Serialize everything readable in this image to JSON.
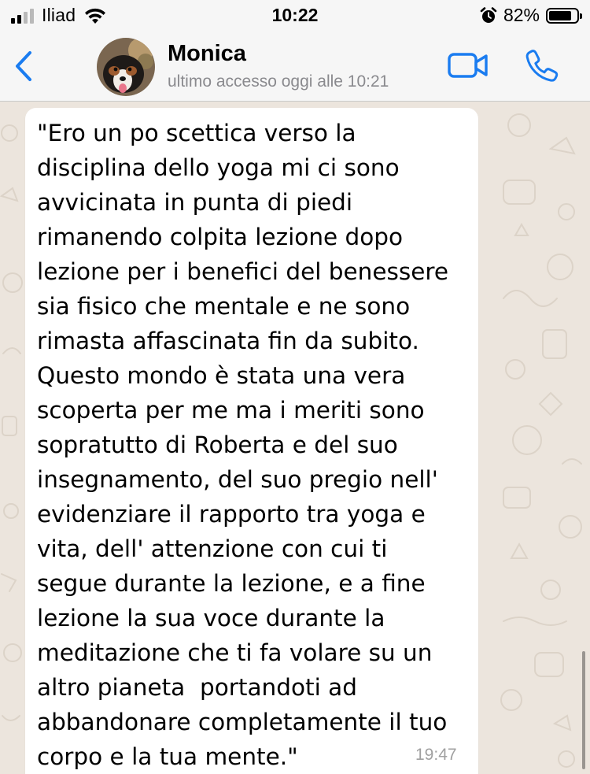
{
  "status_bar": {
    "carrier": "Iliad",
    "time": "10:22",
    "battery_percent": "82%",
    "battery_level": 0.82,
    "icons": [
      "signal-icon",
      "wifi-icon",
      "alarm-icon",
      "battery-icon"
    ]
  },
  "header": {
    "contact_name": "Monica",
    "last_seen": "ultimo accesso oggi alle 10:21",
    "accent_color": "#1a7cf0",
    "icons": [
      "back-chevron-icon",
      "video-camera-icon",
      "phone-icon"
    ]
  },
  "chat": {
    "messages": [
      {
        "lines": [
          "\"Ero un po scettica verso la",
          "disciplina dello yoga mi ci sono",
          "avvicinata in punta di piedi",
          "rimanendo colpita lezione dopo",
          "lezione per i benefici del benessere",
          "sia fisico che mentale e ne sono",
          "rimasta affascinata fin da subito.",
          "Questo mondo è stata una vera",
          "scoperta per me ma i meriti sono",
          "sopratutto di Roberta e del suo",
          "insegnamento, del suo pregio nell'",
          "evidenziare il rapporto tra yoga e",
          "vita, dell' attenzione con cui ti",
          "segue durante la lezione, e a fine",
          "lezione la sua voce durante la",
          "meditazione che ti fa volare su un",
          "altro pianeta  portandoti ad",
          "abbandonare completamente il tuo",
          "corpo e la tua mente.\""
        ],
        "time": "19:47",
        "bubble_color": "#ffffff"
      }
    ],
    "wallpaper_color": "#ece5dd"
  }
}
